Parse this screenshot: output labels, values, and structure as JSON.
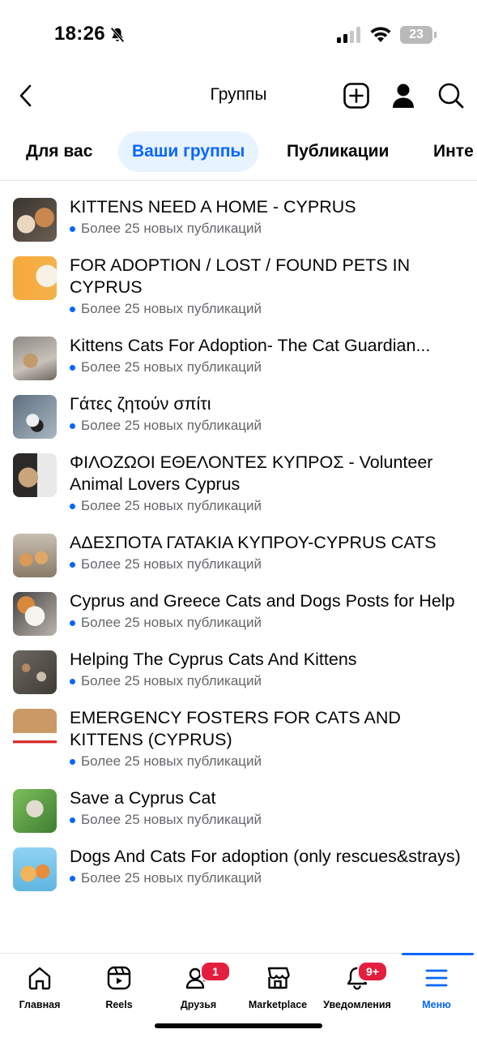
{
  "status_bar": {
    "time": "18:26",
    "battery": "23",
    "icons": [
      "bell-slash-icon",
      "signal-icon",
      "wifi-icon",
      "battery-icon"
    ]
  },
  "header": {
    "title": "Группы",
    "icons": [
      "back-arrow-icon",
      "plus-square-icon",
      "person-icon",
      "search-icon"
    ]
  },
  "tabs": [
    {
      "label": "Для вас",
      "active": false
    },
    {
      "label": "Ваши группы",
      "active": true
    },
    {
      "label": "Публикации",
      "active": false
    },
    {
      "label": "Инте",
      "active": false
    }
  ],
  "groups": [
    {
      "name": "KITTENS NEED A HOME - CYPRUS",
      "meta": "Более 25 новых публикаций"
    },
    {
      "name": "FOR ADOPTION / LOST / FOUND PETS IN CYPRUS",
      "meta": "Более 25 новых публикаций"
    },
    {
      "name": "Kittens Cats For Adoption- The Cat Guardian...",
      "meta": "Более 25 новых публикаций"
    },
    {
      "name": "Γάτες ζητούν σπίτι",
      "meta": "Более 25 новых публикаций"
    },
    {
      "name": "ΦΙΛΟΖΩΟΙ ΕΘΕΛΟΝΤΕΣ ΚΥΠΡΟΣ - Volunteer Animal Lovers Cyprus",
      "meta": "Более 25 новых публикаций"
    },
    {
      "name": "ΑΔΕΣΠΟΤΑ ΓΑΤΑΚΙΑ ΚΥΠΡΟΥ-CYPRUS CATS",
      "meta": "Более 25 новых публикаций"
    },
    {
      "name": "Cyprus and Greece Cats and Dogs Posts for Help",
      "meta": "Более 25 новых публикаций"
    },
    {
      "name": "Helping The Cyprus Cats And Kittens",
      "meta": "Более 25 новых публикаций"
    },
    {
      "name": "EMERGENCY FOSTERS FOR CATS AND KITTENS (CYPRUS)",
      "meta": "Более 25 новых публикаций"
    },
    {
      "name": "Save a Cyprus Cat",
      "meta": "Более 25 новых публикаций"
    },
    {
      "name": "Dogs And Cats For adoption (only rescues&strays)",
      "meta": "Более 25 новых публикаций"
    }
  ],
  "bottom_nav": [
    {
      "label": "Главная",
      "icon": "home-icon",
      "badge": ""
    },
    {
      "label": "Reels",
      "icon": "reels-icon",
      "badge": ""
    },
    {
      "label": "Друзья",
      "icon": "friends-icon",
      "badge": "1"
    },
    {
      "label": "Marketplace",
      "icon": "marketplace-icon",
      "badge": ""
    },
    {
      "label": "Уведомления",
      "icon": "bell-icon",
      "badge": "9+"
    },
    {
      "label": "Меню",
      "icon": "menu-icon",
      "badge": "",
      "active": true
    }
  ],
  "colors": {
    "accent": "#0866ff",
    "active_tab_bg": "#e7f3ff",
    "badge": "#e41e3f",
    "secondary_text": "#65676b"
  }
}
